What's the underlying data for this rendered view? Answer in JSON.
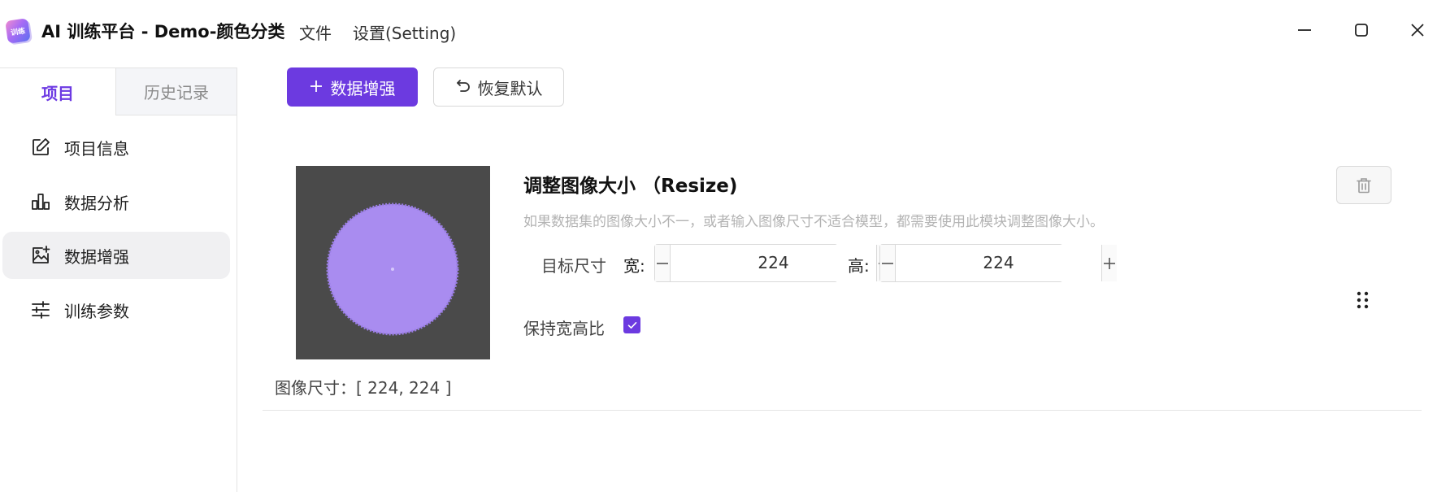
{
  "window": {
    "logo_text": "训练",
    "title": "AI 训练平台 - Demo-颜色分类",
    "menu": [
      "文件",
      "设置(Setting)"
    ],
    "controls": [
      "minimize",
      "maximize",
      "close"
    ]
  },
  "sidebar": {
    "tabs": [
      {
        "label": "项目",
        "active": true
      },
      {
        "label": "历史记录",
        "active": false
      }
    ],
    "items": [
      {
        "label": "项目信息",
        "icon": "edit-icon",
        "selected": false
      },
      {
        "label": "数据分析",
        "icon": "bar-chart-icon",
        "selected": false
      },
      {
        "label": "数据增强",
        "icon": "image-add-icon",
        "selected": true
      },
      {
        "label": "训练参数",
        "icon": "sliders-icon",
        "selected": false
      }
    ]
  },
  "toolbar": {
    "add_label": "数据增强",
    "reset_label": "恢复默认"
  },
  "card": {
    "title": "调整图像大小 （Resize)",
    "description": "如果数据集的图像大小不一，或者输入图像尺寸不适合模型，都需要使用此模块调整图像大小。",
    "target_size_label": "目标尺寸",
    "width_label": "宽:",
    "width_value": "224",
    "height_label": "高:",
    "height_value": "224",
    "keep_ratio_label": "保持宽高比",
    "keep_ratio_checked": true,
    "image_size_caption": "图像尺寸：[ 224, 224 ]"
  },
  "colors": {
    "accent": "#6c3ae0",
    "preview_background": "#4a4a4a",
    "preview_circle": "#a98cf0"
  }
}
